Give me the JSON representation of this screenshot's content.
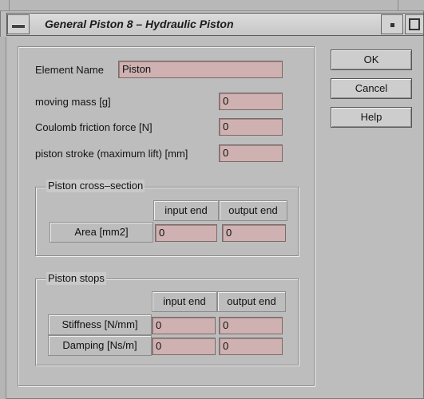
{
  "window": {
    "title": "General Piston 8 – Hydraulic Piston"
  },
  "form": {
    "element_name": {
      "label": "Element Name",
      "value": "Piston"
    },
    "moving_mass": {
      "label": "moving mass [g]",
      "value": "0"
    },
    "coulomb_friction": {
      "label": "Coulomb friction force [N]",
      "value": "0"
    },
    "piston_stroke": {
      "label": "piston stroke (maximum lift) [mm]",
      "value": "0"
    }
  },
  "cross_section": {
    "title": "Piston cross–section",
    "col_input": "input end",
    "col_output": "output end",
    "area": {
      "label": "Area [mm2]",
      "input": "0",
      "output": "0"
    }
  },
  "stops": {
    "title": "Piston stops",
    "col_input": "input end",
    "col_output": "output end",
    "stiffness": {
      "label": "Stiffness [N/mm]",
      "input": "0",
      "output": "0"
    },
    "damping": {
      "label": "Damping [Ns/m]",
      "input": "0",
      "output": "0"
    }
  },
  "buttons": {
    "ok": "OK",
    "cancel": "Cancel",
    "help": "Help"
  },
  "colors": {
    "field_bg": "#cfb1b1",
    "window_bg": "#c9c9c9"
  }
}
